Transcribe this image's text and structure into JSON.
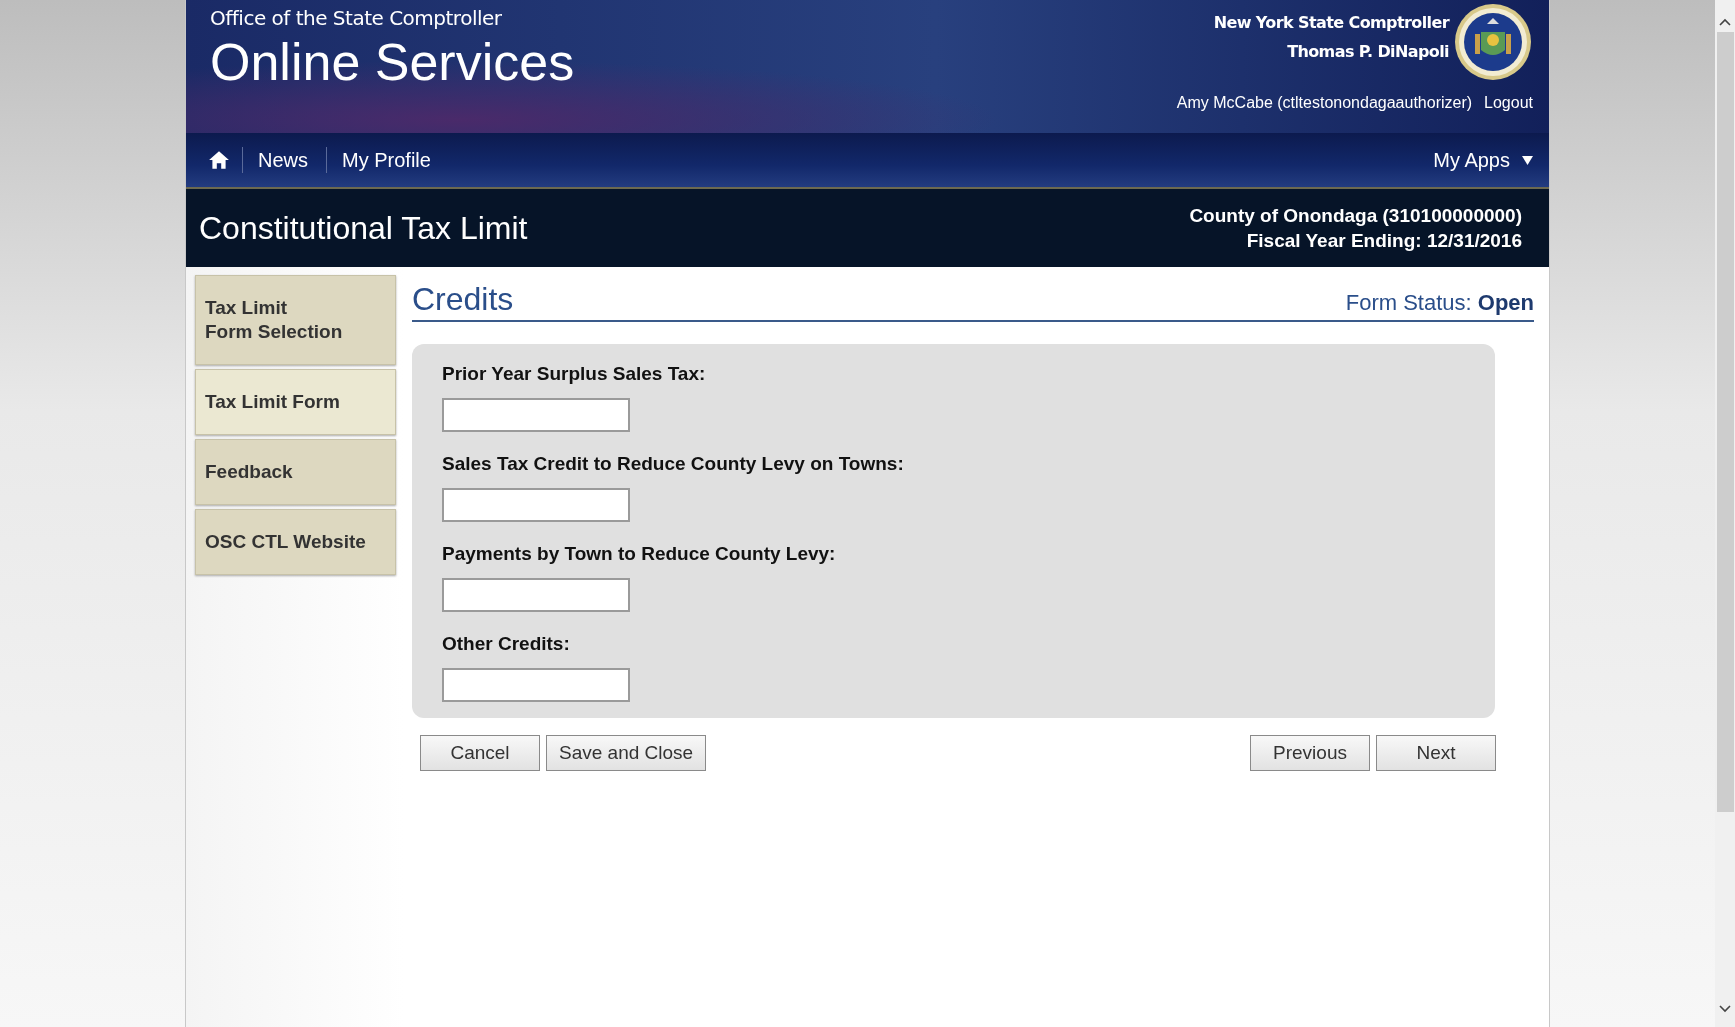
{
  "header": {
    "office": "Office of the State Comptroller",
    "title": "Online Services",
    "official_lines": [
      "New York State Comptroller",
      "Thomas P. DiNapoli"
    ],
    "user": "Amy McCabe (ctltestonondagaauthorizer)",
    "logout": "Logout"
  },
  "nav": {
    "items": [
      "News",
      "My Profile"
    ],
    "apps_menu": "My Apps"
  },
  "app_bar": {
    "title": "Constitutional Tax Limit",
    "entity": "County of Onondaga (310100000000)",
    "fiscal_year": "Fiscal Year Ending: 12/31/2016"
  },
  "sidebar": {
    "items": [
      {
        "label": "Tax Limit\nForm Selection",
        "selected": false
      },
      {
        "label": "Tax Limit Form",
        "selected": true
      },
      {
        "label": "Feedback",
        "selected": false
      },
      {
        "label": "OSC CTL Website",
        "selected": false
      }
    ]
  },
  "page": {
    "heading": "Credits",
    "form_status": "Form Status: **Open**"
  },
  "form": {
    "fields": [
      {
        "label": "Prior Year Surplus Sales Tax:"
      },
      {
        "label": "Sales Tax Credit to Reduce County Levy on Towns:"
      },
      {
        "label": "Payments by Town to Reduce County Levy:"
      },
      {
        "label": "Other Credits:"
      }
    ]
  },
  "buttons_left": [
    "Cancel",
    "Save and Close"
  ],
  "buttons_right": [
    "Previous",
    "Next"
  ]
}
